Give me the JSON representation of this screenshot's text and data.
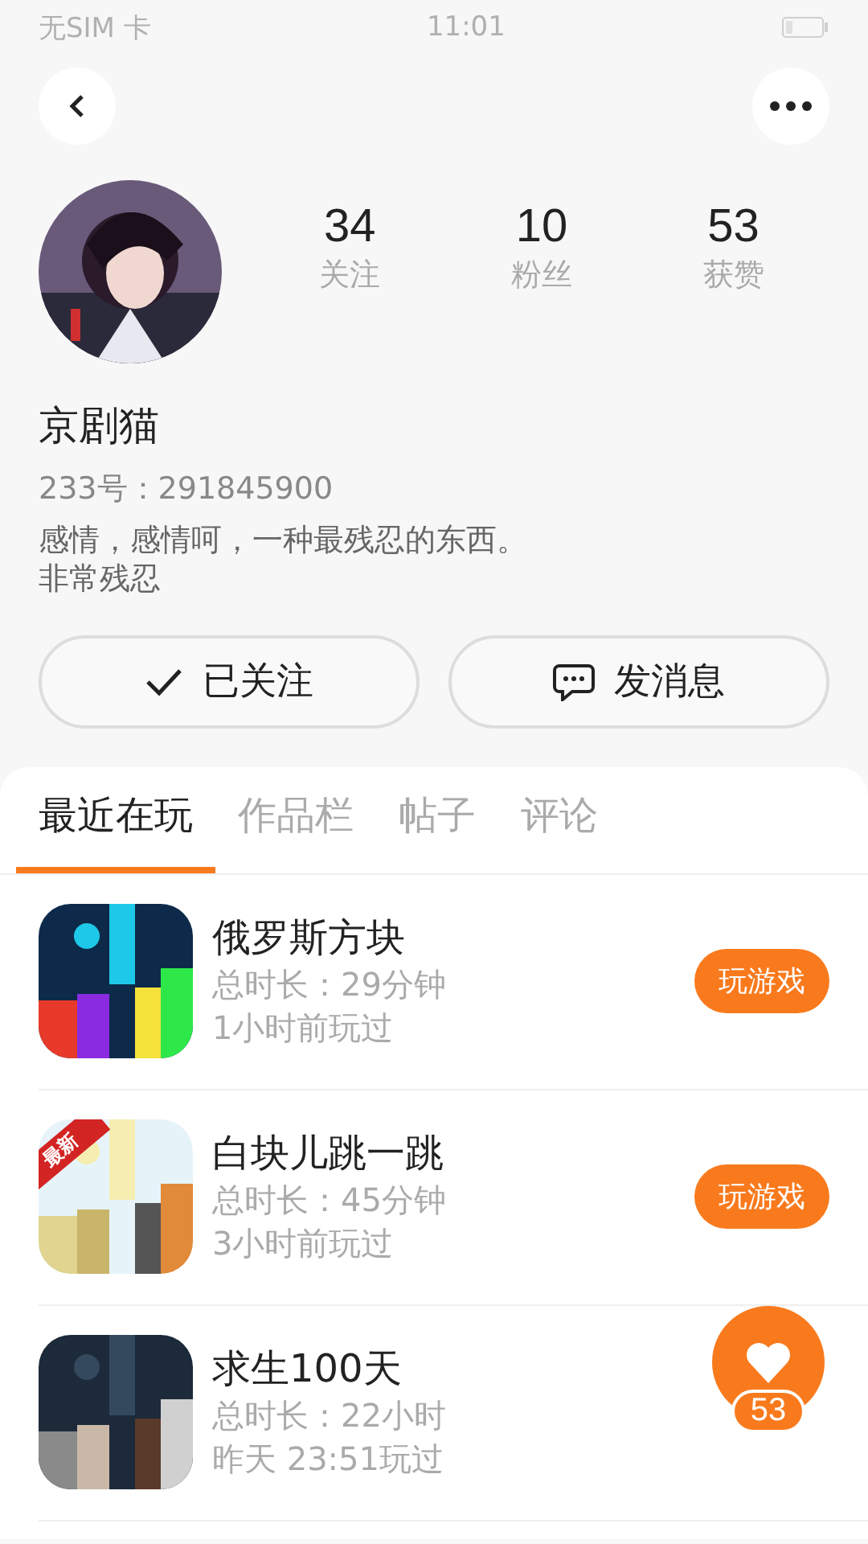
{
  "status_bar": {
    "carrier": "无SIM 卡",
    "time": "11:01"
  },
  "profile": {
    "name": "京剧猫",
    "id_line": "233号：291845900",
    "bio": [
      "感情，感情呵，一种最残忍的东西。",
      "非常残忍"
    ],
    "stats": [
      {
        "value": "34",
        "label": "关注"
      },
      {
        "value": "10",
        "label": "粉丝"
      },
      {
        "value": "53",
        "label": "获赞"
      }
    ]
  },
  "actions": [
    {
      "kind": "follow",
      "label": "已关注"
    },
    {
      "kind": "message",
      "label": "发消息"
    }
  ],
  "tabs": [
    {
      "label": "最近在玩",
      "selected": true
    },
    {
      "label": "作品栏",
      "selected": false
    },
    {
      "label": "帖子",
      "selected": false
    },
    {
      "label": "评论",
      "selected": false
    }
  ],
  "games": [
    {
      "title": "俄罗斯方块",
      "duration": "总时长：29分钟",
      "last_played": "1小时前玩过",
      "button": "玩游戏"
    },
    {
      "title": "白块儿跳一跳",
      "duration": "总时长：45分钟",
      "last_played": "3小时前玩过",
      "button": "玩游戏",
      "badge": "最新"
    },
    {
      "title": "求生100天",
      "duration": "总时长：22小时",
      "last_played": "昨天 23:51玩过"
    }
  ],
  "like_fab": {
    "count": "53"
  }
}
